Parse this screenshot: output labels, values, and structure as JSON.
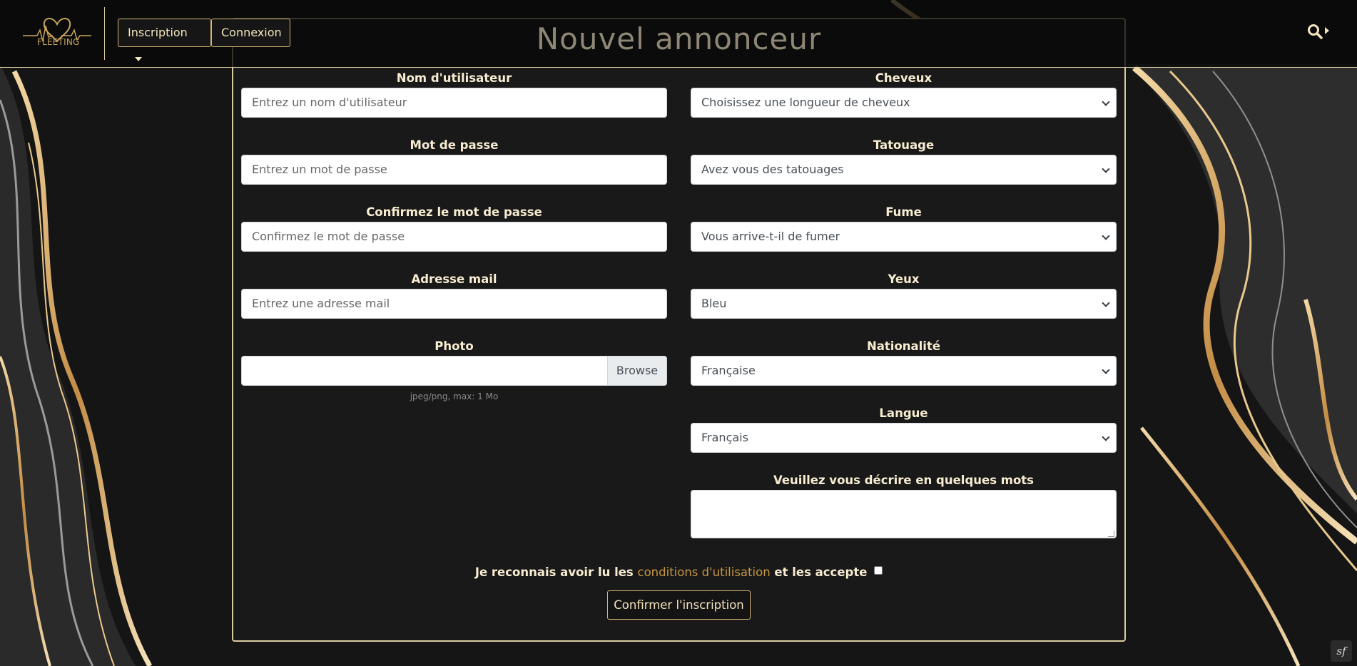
{
  "navbar": {
    "logo_text": "FLEETING",
    "inscription_label": "Inscription",
    "connexion_label": "Connexion"
  },
  "form": {
    "title": "Nouvel annonceur",
    "left": [
      {
        "label": "Nom d'utilisateur",
        "placeholder": "Entrez un nom d'utilisateur"
      },
      {
        "label": "Mot de passe",
        "placeholder": "Entrez un mot de passe"
      },
      {
        "label": "Confirmez le mot de passe",
        "placeholder": "Confirmez le mot de passe"
      },
      {
        "label": "Adresse mail",
        "placeholder": "Entrez une adresse mail"
      },
      {
        "label": "Photo",
        "button": "Browse",
        "hint": "jpeg/png, max: 1 Mo"
      }
    ],
    "right": [
      {
        "label": "Cheveux",
        "value": "Choisissez une longueur de cheveux"
      },
      {
        "label": "Tatouage",
        "value": "Avez vous des tatouages"
      },
      {
        "label": "Fume",
        "value": "Vous arrive-t-il de fumer"
      },
      {
        "label": "Yeux",
        "value": "Bleu"
      },
      {
        "label": "Nationalité",
        "value": "Française"
      },
      {
        "label": "Langue",
        "value": "Français"
      },
      {
        "label": "Veuillez vous décrire en quelques mots",
        "value": ""
      }
    ],
    "terms_before": "Je reconnais avoir lu les ",
    "terms_link": "conditions d'utilisation",
    "terms_after": " et les accepte",
    "submit_label": "Confirmer l'inscription"
  },
  "colors": {
    "gold": "#d4b676",
    "cream_text": "#f8edd2",
    "link": "#c8963e",
    "background": "#151515"
  },
  "symfony_badge": "sf"
}
